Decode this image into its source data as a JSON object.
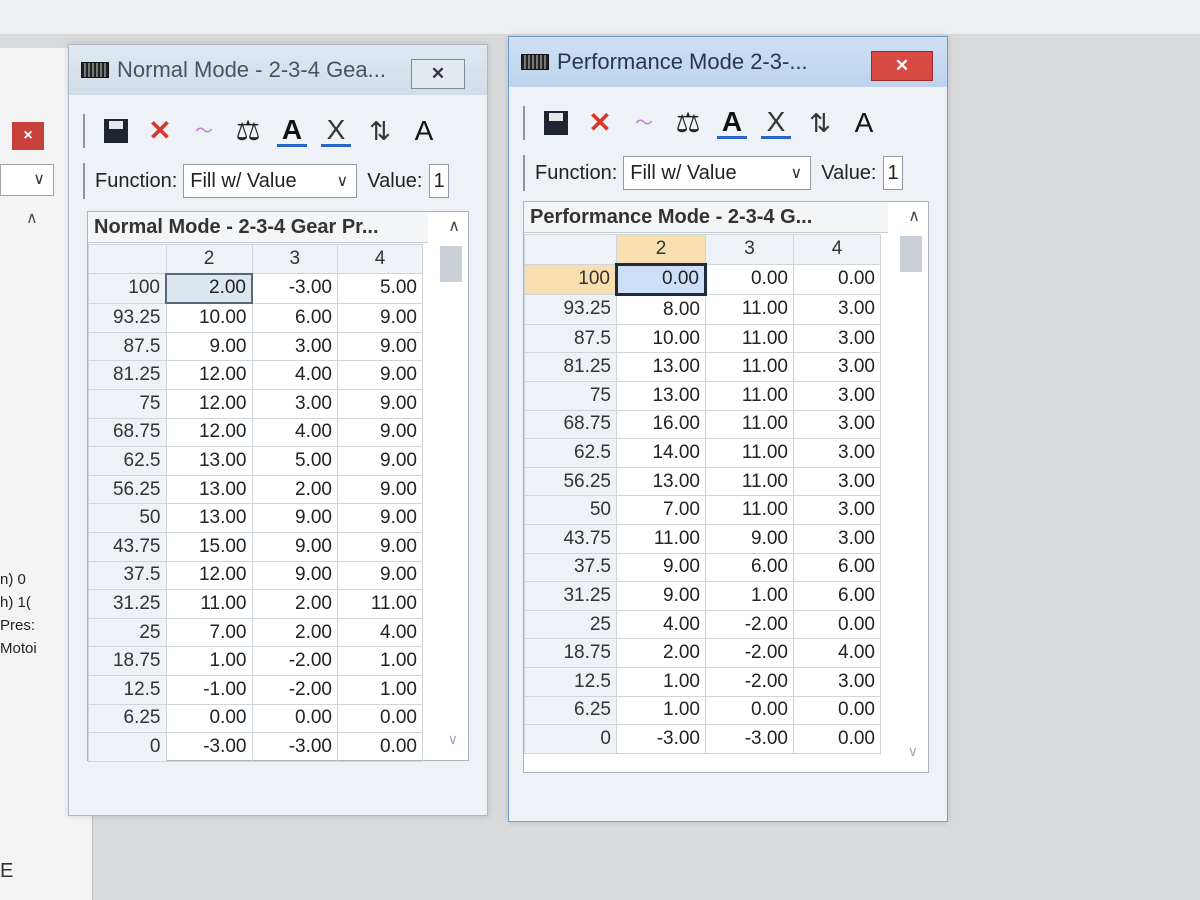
{
  "left_panel": {
    "close_glyph": "×",
    "labels": [
      "n) 0",
      "h) 1(",
      "Pres:",
      "Motoi"
    ],
    "bottom_letter": "E"
  },
  "toolbar_icons": [
    "save-icon",
    "delete-icon",
    "graph-icon",
    "scale-icon",
    "text-a-icon",
    "clear-icon",
    "sort-arrows-icon",
    "font-a-icon"
  ],
  "function_label": "Function:",
  "function_value": "Fill w/ Value",
  "value_label": "Value:",
  "value_input": "1",
  "normal": {
    "window_title": "Normal Mode - 2-3-4 Gea...",
    "grid_title": "Normal Mode - 2-3-4 Gear Pr...",
    "columns": [
      "2",
      "3",
      "4"
    ],
    "rows": [
      {
        "label": "100",
        "values": [
          "2.00",
          "-3.00",
          "5.00"
        ]
      },
      {
        "label": "93.25",
        "values": [
          "10.00",
          "6.00",
          "9.00"
        ]
      },
      {
        "label": "87.5",
        "values": [
          "9.00",
          "3.00",
          "9.00"
        ]
      },
      {
        "label": "81.25",
        "values": [
          "12.00",
          "4.00",
          "9.00"
        ]
      },
      {
        "label": "75",
        "values": [
          "12.00",
          "3.00",
          "9.00"
        ]
      },
      {
        "label": "68.75",
        "values": [
          "12.00",
          "4.00",
          "9.00"
        ]
      },
      {
        "label": "62.5",
        "values": [
          "13.00",
          "5.00",
          "9.00"
        ]
      },
      {
        "label": "56.25",
        "values": [
          "13.00",
          "2.00",
          "9.00"
        ]
      },
      {
        "label": "50",
        "values": [
          "13.00",
          "9.00",
          "9.00"
        ]
      },
      {
        "label": "43.75",
        "values": [
          "15.00",
          "9.00",
          "9.00"
        ]
      },
      {
        "label": "37.5",
        "values": [
          "12.00",
          "9.00",
          "9.00"
        ]
      },
      {
        "label": "31.25",
        "values": [
          "11.00",
          "2.00",
          "11.00"
        ]
      },
      {
        "label": "25",
        "values": [
          "7.00",
          "2.00",
          "4.00"
        ]
      },
      {
        "label": "18.75",
        "values": [
          "1.00",
          "-2.00",
          "1.00"
        ]
      },
      {
        "label": "12.5",
        "values": [
          "-1.00",
          "-2.00",
          "1.00"
        ]
      },
      {
        "label": "6.25",
        "values": [
          "0.00",
          "0.00",
          "0.00"
        ]
      },
      {
        "label": "0",
        "values": [
          "-3.00",
          "-3.00",
          "0.00"
        ]
      }
    ]
  },
  "perf": {
    "window_title": "Performance Mode 2-3-...",
    "grid_title": "Performance Mode - 2-3-4 G...",
    "columns": [
      "2",
      "3",
      "4"
    ],
    "rows": [
      {
        "label": "100",
        "values": [
          "0.00",
          "0.00",
          "0.00"
        ]
      },
      {
        "label": "93.25",
        "values": [
          "8.00",
          "11.00",
          "3.00"
        ]
      },
      {
        "label": "87.5",
        "values": [
          "10.00",
          "11.00",
          "3.00"
        ]
      },
      {
        "label": "81.25",
        "values": [
          "13.00",
          "11.00",
          "3.00"
        ]
      },
      {
        "label": "75",
        "values": [
          "13.00",
          "11.00",
          "3.00"
        ]
      },
      {
        "label": "68.75",
        "values": [
          "16.00",
          "11.00",
          "3.00"
        ]
      },
      {
        "label": "62.5",
        "values": [
          "14.00",
          "11.00",
          "3.00"
        ]
      },
      {
        "label": "56.25",
        "values": [
          "13.00",
          "11.00",
          "3.00"
        ]
      },
      {
        "label": "50",
        "values": [
          "7.00",
          "11.00",
          "3.00"
        ]
      },
      {
        "label": "43.75",
        "values": [
          "11.00",
          "9.00",
          "3.00"
        ]
      },
      {
        "label": "37.5",
        "values": [
          "9.00",
          "6.00",
          "6.00"
        ]
      },
      {
        "label": "31.25",
        "values": [
          "9.00",
          "1.00",
          "6.00"
        ]
      },
      {
        "label": "25",
        "values": [
          "4.00",
          "-2.00",
          "0.00"
        ]
      },
      {
        "label": "18.75",
        "values": [
          "2.00",
          "-2.00",
          "4.00"
        ]
      },
      {
        "label": "12.5",
        "values": [
          "1.00",
          "-2.00",
          "3.00"
        ]
      },
      {
        "label": "6.25",
        "values": [
          "1.00",
          "0.00",
          "0.00"
        ]
      },
      {
        "label": "0",
        "values": [
          "-3.00",
          "-3.00",
          "0.00"
        ]
      }
    ]
  },
  "colors": {
    "selected_cell_perf": "#cde0f7",
    "highlight_header": "#f8dfb0",
    "close_button_active": "#d94b42"
  }
}
